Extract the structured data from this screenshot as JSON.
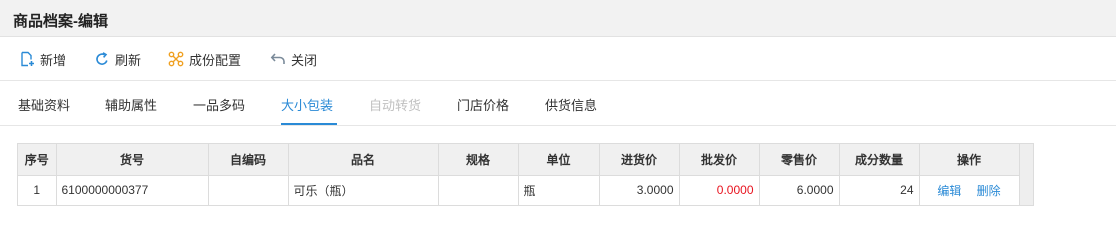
{
  "page": {
    "title": "商品档案-编辑"
  },
  "toolbar": {
    "buttons": [
      {
        "label": "新增",
        "icon": "add-file-icon"
      },
      {
        "label": "刷新",
        "icon": "refresh-icon"
      },
      {
        "label": "成份配置",
        "icon": "component-config-icon"
      },
      {
        "label": "关闭",
        "icon": "back-arrow-icon"
      }
    ]
  },
  "tabs": [
    {
      "label": "基础资料",
      "state": "normal"
    },
    {
      "label": "辅助属性",
      "state": "normal"
    },
    {
      "label": "一品多码",
      "state": "normal"
    },
    {
      "label": "大小包装",
      "state": "active"
    },
    {
      "label": "自动转货",
      "state": "disabled"
    },
    {
      "label": "门店价格",
      "state": "normal"
    },
    {
      "label": "供货信息",
      "state": "normal"
    }
  ],
  "table": {
    "headers": [
      "序号",
      "货号",
      "自编码",
      "品名",
      "规格",
      "单位",
      "进货价",
      "批发价",
      "零售价",
      "成分数量",
      "操作"
    ],
    "rows": [
      {
        "index": "1",
        "code": "6100000000377",
        "custom_code": "",
        "name": "可乐（瓶）",
        "spec": "",
        "unit": "瓶",
        "purchase_price": "3.0000",
        "wholesale_price": "0.0000",
        "retail_price": "6.0000",
        "component_qty": "24",
        "actions": [
          "编辑",
          "删除"
        ]
      }
    ]
  },
  "colors": {
    "accent": "#2a8ad6",
    "warning": "#e8131f",
    "disabled": "#c0c0c0"
  }
}
